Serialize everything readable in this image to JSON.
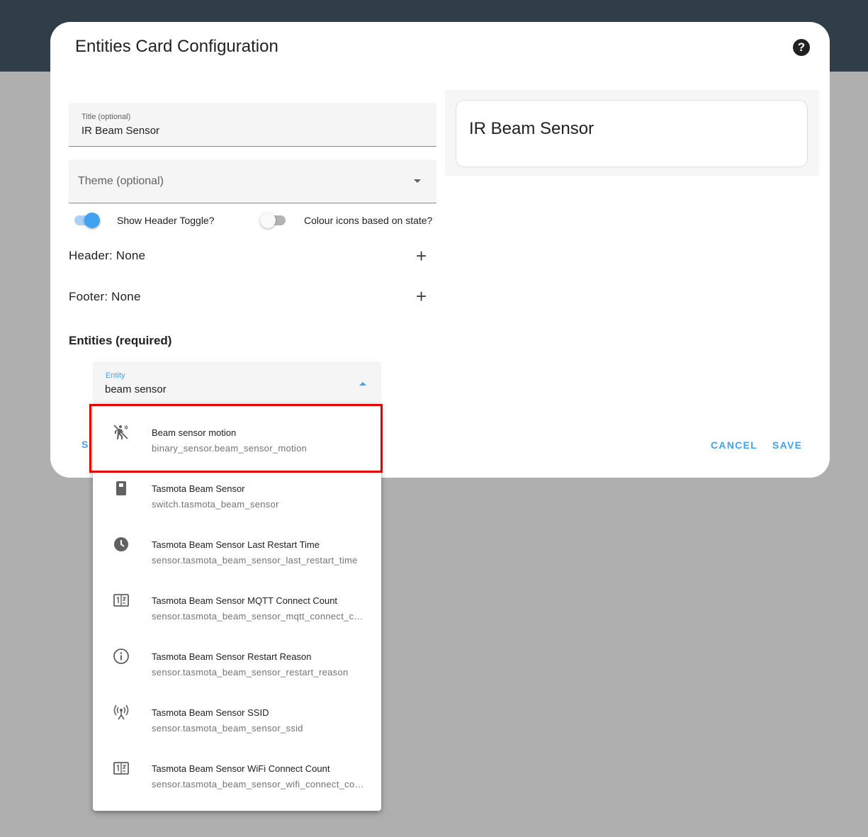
{
  "dialog": {
    "title": "Entities Card Configuration",
    "help_icon": "help-circle-icon"
  },
  "form": {
    "title_field": {
      "label": "Title (optional)",
      "value": "IR Beam Sensor"
    },
    "theme_field": {
      "placeholder": "Theme (optional)"
    },
    "show_header_toggle": {
      "label": "Show Header Toggle?",
      "checked": true
    },
    "colour_icons_toggle": {
      "label": "Colour icons based on state?",
      "checked": false
    },
    "header_row": {
      "label": "Header: None"
    },
    "footer_row": {
      "label": "Footer: None"
    },
    "entities_heading": "Entities (required)",
    "partial_button_letter": "S"
  },
  "entity_picker": {
    "label": "Entity",
    "value": "beam sensor",
    "options": [
      {
        "name": "Beam sensor motion",
        "entity_id": "binary_sensor.beam_sensor_motion",
        "icon": "motion-sensor-off-icon"
      },
      {
        "name": "Tasmota Beam Sensor",
        "entity_id": "switch.tasmota_beam_sensor",
        "icon": "switch-device-icon"
      },
      {
        "name": "Tasmota Beam Sensor Last Restart Time",
        "entity_id": "sensor.tasmota_beam_sensor_last_restart_time",
        "icon": "clock-icon"
      },
      {
        "name": "Tasmota Beam Sensor MQTT Connect Count",
        "entity_id": "sensor.tasmota_beam_sensor_mqtt_connect_count",
        "icon": "counter-icon"
      },
      {
        "name": "Tasmota Beam Sensor Restart Reason",
        "entity_id": "sensor.tasmota_beam_sensor_restart_reason",
        "icon": "info-icon"
      },
      {
        "name": "Tasmota Beam Sensor SSID",
        "entity_id": "sensor.tasmota_beam_sensor_ssid",
        "icon": "access-point-icon"
      },
      {
        "name": "Tasmota Beam Sensor WiFi Connect Count",
        "entity_id": "sensor.tasmota_beam_sensor_wifi_connect_count",
        "icon": "counter-icon"
      }
    ]
  },
  "preview": {
    "card_title": "IR Beam Sensor"
  },
  "actions": {
    "cancel": "CANCEL",
    "save": "SAVE"
  },
  "colors": {
    "accent": "#41a3f0",
    "highlight_border": "#e60000",
    "top_bar": "#2f3e48",
    "backdrop": "#afafaf"
  }
}
